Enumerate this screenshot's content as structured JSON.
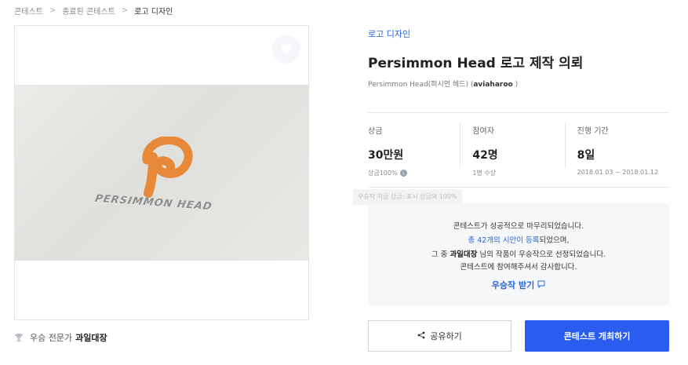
{
  "breadcrumb": {
    "items": [
      "콘테스트",
      "종료된 콘테스트",
      "로고 디자인"
    ],
    "separator": ">"
  },
  "photo": {
    "logo_text": "PERSIMMON HEAD",
    "logo_color": "#e8893a"
  },
  "winner": {
    "prefix": "우승 전문가",
    "name": "과일대장"
  },
  "contest": {
    "category": "로고 디자인",
    "title": "Persimmon Head 로고 제작 의뢰",
    "subtitle_main": "Persimmon Head(퍼시먼 헤드) (",
    "subtitle_user": "aviaharoo",
    "subtitle_end": " )"
  },
  "stats": {
    "prize": {
      "label": "상금",
      "value": "30만원",
      "sub": "상금100%",
      "info_icon": "i"
    },
    "participants": {
      "label": "참여자",
      "value": "42명",
      "sub": "1명 수상"
    },
    "period": {
      "label": "진행 기간",
      "value": "8일",
      "sub": "2018.01.03 ~ 2018.01.12"
    }
  },
  "tooltip": "우승작 지급 상금: 표시 상금의 100%",
  "result": {
    "line1": "콘테스트가 성공적으로 마무리되었습니다.",
    "line2_blue": "총 42개의 시안이 등록",
    "line2_rest": "되었으며,",
    "line3_pre": "그 중 ",
    "line3_name": "과일대장",
    "line3_post": " 님의 작품이 우승작으로 선정되었습니다.",
    "line4": "콘테스트에 참여해주셔서 감사합니다.",
    "receive_label": "우승작 받기"
  },
  "buttons": {
    "share": "공유하기",
    "host": "콘테스트 개최하기"
  },
  "colors": {
    "accent": "#2b5cf0",
    "link": "#2a64d9",
    "logo_orange": "#e8893a"
  },
  "icons": [
    "heart-icon",
    "trophy-icon",
    "info-icon",
    "speech-bubble-icon",
    "share-icon"
  ]
}
